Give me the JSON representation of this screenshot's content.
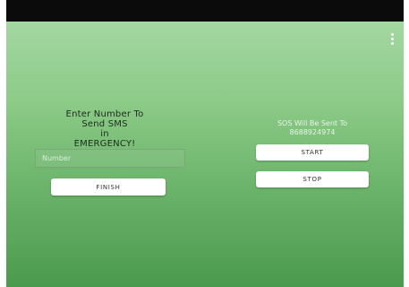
{
  "menu": {
    "icon": "more-vert-icon"
  },
  "left_panel": {
    "heading_lines": [
      "Enter Number To",
      "Send SMS",
      "in",
      "EMERGENCY!"
    ],
    "number_input": {
      "placeholder": "Number",
      "value": ""
    },
    "finish_label": "FINISH"
  },
  "right_panel": {
    "sos_label": "SOS Will Be Sent To",
    "sos_number": "8688924974",
    "start_label": "START",
    "stop_label": "STOP"
  }
}
